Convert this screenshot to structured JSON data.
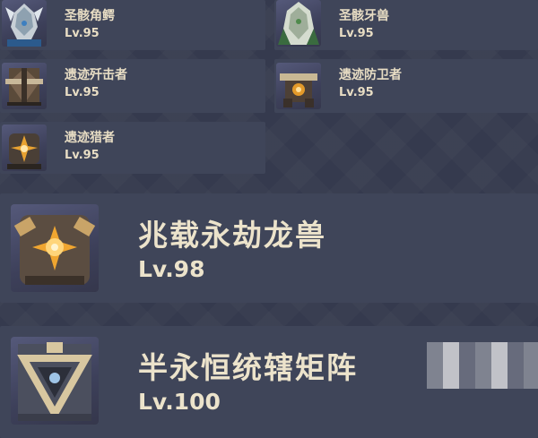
{
  "colors": {
    "background": "#353a4e",
    "card": "#3f4559",
    "text": "#e8ddc4"
  },
  "enemies_small": [
    {
      "name": "圣骸角鳄",
      "level": "Lv.95",
      "icon": "saurian-relic-horned-icon"
    },
    {
      "name": "圣骸牙兽",
      "level": "Lv.95",
      "icon": "saurian-relic-fanged-icon"
    },
    {
      "name": "遗迹歼击者",
      "level": "Lv.95",
      "icon": "ruin-destroyer-icon"
    },
    {
      "name": "遗迹防卫者",
      "level": "Lv.95",
      "icon": "ruin-defender-icon"
    },
    {
      "name": "遗迹猎者",
      "level": "Lv.95",
      "icon": "ruin-hunter-icon"
    }
  ],
  "enemies_large": [
    {
      "name": "兆载永劫龙兽",
      "level": "Lv.98",
      "icon": "perpetual-mechanical-beast-icon"
    },
    {
      "name": "半永恒统辖矩阵",
      "level": "Lv.100",
      "icon": "semi-perpetual-matrix-icon"
    }
  ]
}
